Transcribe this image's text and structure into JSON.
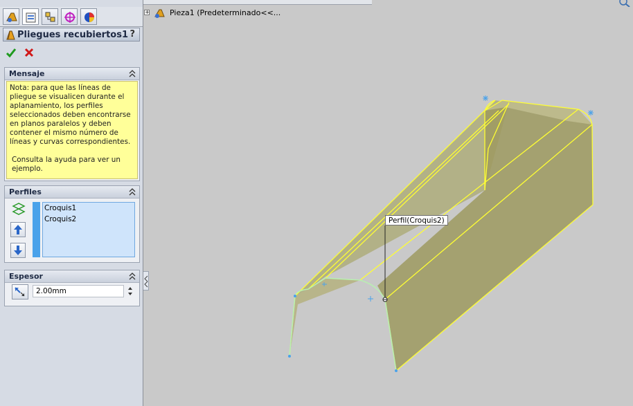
{
  "property_manager": {
    "title": "Pliegues recubiertos1",
    "help": "?",
    "icons": [
      "feature-manager-icon",
      "property-manager-icon",
      "configuration-manager-icon",
      "dimxpert-icon",
      "display-manager-icon"
    ]
  },
  "message": {
    "heading": "Mensaje",
    "line1": "Nota: para que las líneas de pliegue se visualicen durante el aplanamiento, los perfiles seleccionados deben encontrarse en planos paralelos y deben contener el mismo número de líneas y curvas correspondientes.",
    "line2": "Consulta la ayuda para ver un ejemplo."
  },
  "profiles": {
    "heading": "Perfiles",
    "items": [
      "Croquis1",
      "Croquis2"
    ]
  },
  "thickness": {
    "heading": "Espesor",
    "value": "2.00mm"
  },
  "tree": {
    "part_label": "Pieza1  (Predeterminado<<..."
  },
  "viewport": {
    "tooltip": "Perfil(Croquis2)"
  },
  "colors": {
    "accent_blue": "#4aa2ea",
    "message_bg": "#ffff99",
    "model_edge": "#ffff33",
    "viewport_bg": "#c9c9c9"
  }
}
